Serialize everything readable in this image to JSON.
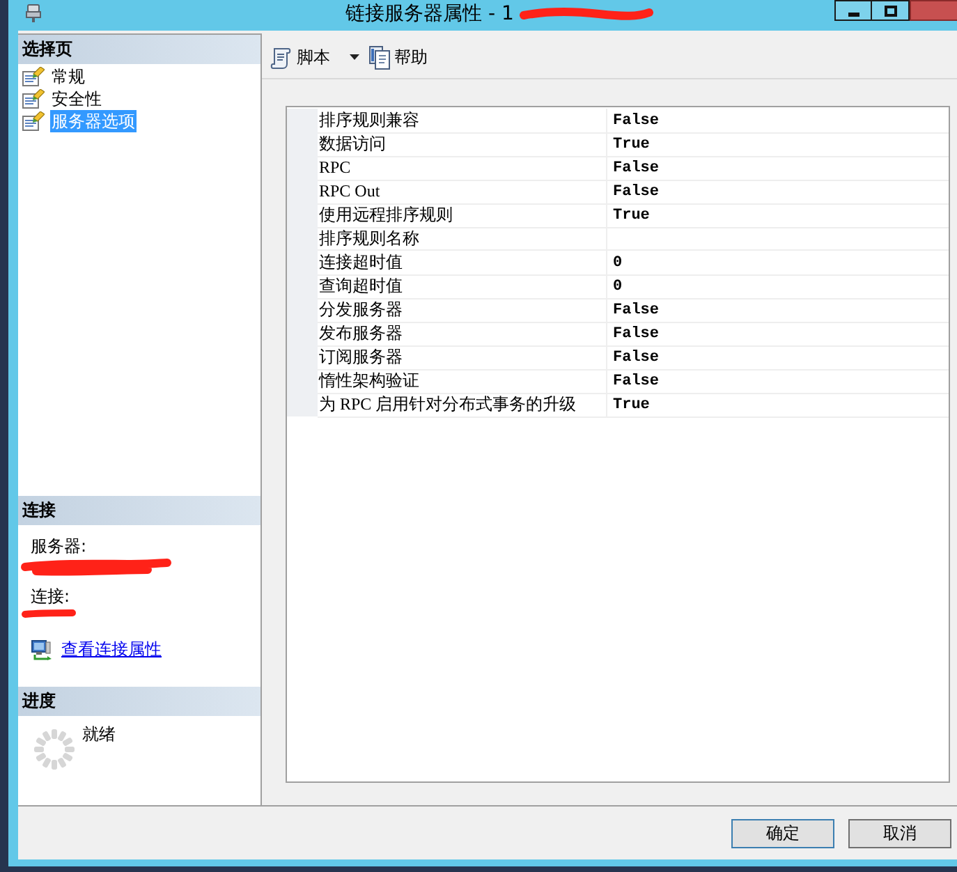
{
  "window": {
    "title": "链接服务器属性 - 1"
  },
  "select_page": {
    "header": "选择页",
    "items": [
      {
        "label": "常规",
        "selected": false
      },
      {
        "label": "安全性",
        "selected": false
      },
      {
        "label": "服务器选项",
        "selected": true
      }
    ]
  },
  "connection": {
    "header": "连接",
    "server_label": "服务器:",
    "connection_label": "连接:",
    "link": "查看连接属性"
  },
  "progress": {
    "header": "进度",
    "status": "就绪"
  },
  "toolbar": [
    {
      "kind": "script",
      "label": "脚本"
    },
    {
      "kind": "help",
      "label": "帮助"
    }
  ],
  "properties": [
    {
      "name": "排序规则兼容",
      "value": "False"
    },
    {
      "name": "数据访问",
      "value": "True"
    },
    {
      "name": "RPC",
      "value": "False"
    },
    {
      "name": "RPC Out",
      "value": "False"
    },
    {
      "name": "使用远程排序规则",
      "value": "True"
    },
    {
      "name": "排序规则名称"
    },
    {
      "name": "连接超时值",
      "value": "0"
    },
    {
      "name": "查询超时值",
      "value": "0"
    },
    {
      "name": "分发服务器",
      "value": "False"
    },
    {
      "name": "发布服务器",
      "value": "False"
    },
    {
      "name": "订阅服务器",
      "value": "False"
    },
    {
      "name": "惰性架构验证",
      "value": "False"
    },
    {
      "name": "为 RPC 启用针对分布式事务的升级",
      "value": "True"
    }
  ],
  "buttons": [
    {
      "label": "确定",
      "default": true
    },
    {
      "label": "取消",
      "default": false
    }
  ]
}
